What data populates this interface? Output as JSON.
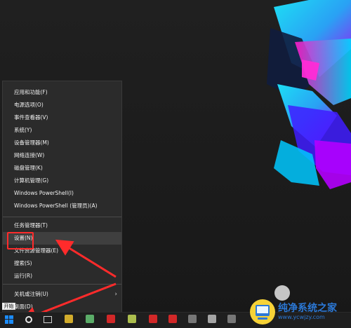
{
  "desktop": {
    "menu": {
      "items": [
        "应用和功能(F)",
        "电源选项(O)",
        "事件查看器(V)",
        "系统(Y)",
        "设备管理器(M)",
        "网络连接(W)",
        "磁盘管理(K)",
        "计算机管理(G)",
        "Windows PowerShell(I)",
        "Windows PowerShell (管理员)(A)",
        "任务管理器(T)",
        "设置(N)",
        "文件资源管理器(E)",
        "搜索(S)",
        "运行(R)",
        "关机或注销(U)",
        "桌面(D)"
      ]
    },
    "taskbar": {
      "start_tooltip": "开始"
    },
    "watermark": {
      "title": "纯净系统之家",
      "subtitle": "www.ycwjzy.com"
    }
  }
}
